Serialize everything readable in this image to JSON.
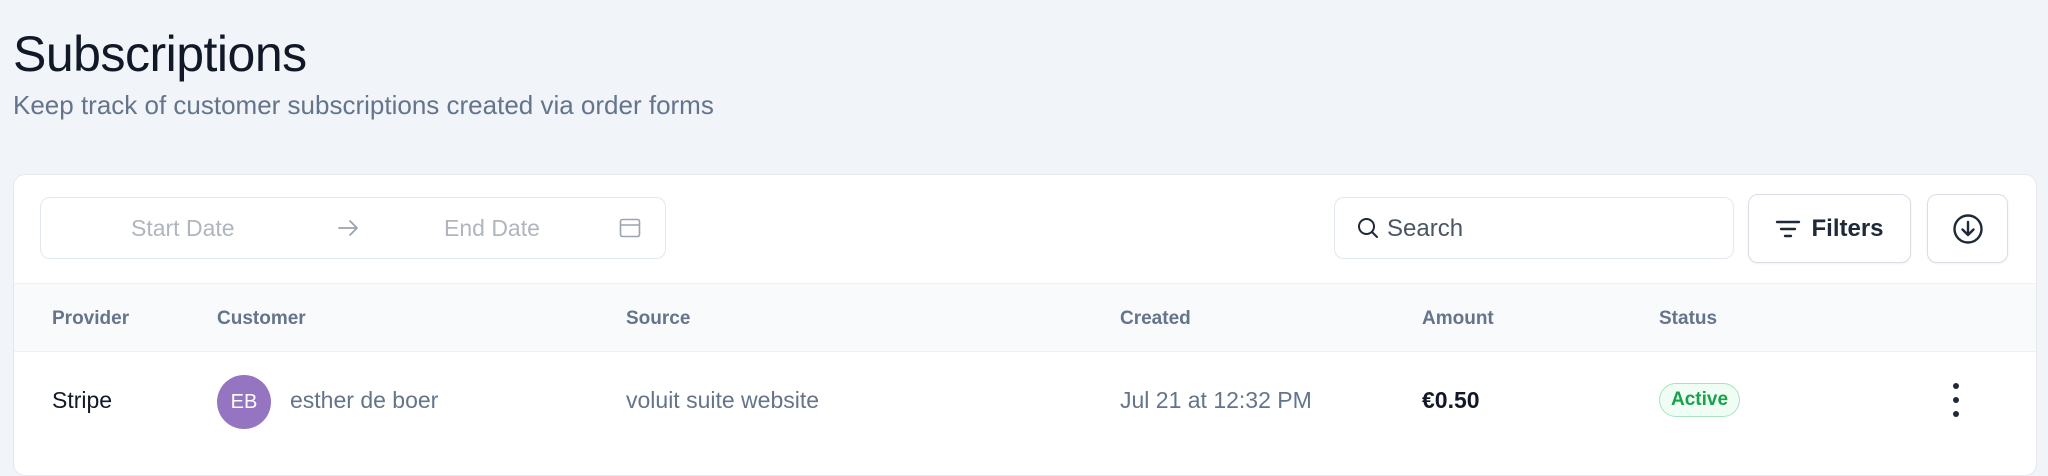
{
  "header": {
    "title": "Subscriptions",
    "subtitle": "Keep track of customer subscriptions created via order forms"
  },
  "toolbar": {
    "date_range": {
      "start_placeholder": "Start Date",
      "end_placeholder": "End Date"
    },
    "search": {
      "placeholder": "Search",
      "value": ""
    },
    "filters_label": "Filters"
  },
  "table": {
    "columns": [
      "Provider",
      "Customer",
      "Source",
      "Created",
      "Amount",
      "Status"
    ],
    "rows": [
      {
        "provider": "Stripe",
        "customer_initials": "EB",
        "customer_name": "esther de boer",
        "source": "voluit suite website",
        "created": "Jul 21 at 12:32 PM",
        "amount": "€0.50",
        "status": "Active"
      }
    ]
  },
  "icons": {
    "arrow": "arrow-right-icon",
    "calendar": "calendar-icon",
    "search": "search-icon",
    "filter": "filter-lines-icon",
    "download": "download-circle-icon",
    "more": "more-vertical-icon"
  },
  "colors": {
    "background": "#f1f5f9",
    "avatar": "#9575c2",
    "status_active": "#16a34a"
  }
}
